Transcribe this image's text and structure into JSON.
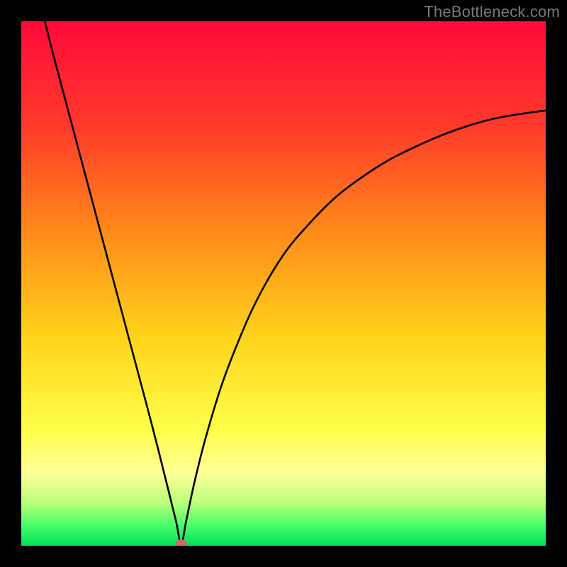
{
  "watermark": "TheBottleneck.com",
  "chart_data": {
    "type": "line",
    "title": "",
    "xlabel": "",
    "ylabel": "",
    "xlim": [
      0,
      100
    ],
    "ylim": [
      0,
      100
    ],
    "gradient_stops": [
      {
        "offset": 0,
        "color": "#ff0a3a"
      },
      {
        "offset": 20,
        "color": "#ff3a2a"
      },
      {
        "offset": 40,
        "color": "#ff8a1a"
      },
      {
        "offset": 60,
        "color": "#ffd21a"
      },
      {
        "offset": 78,
        "color": "#ffff4a"
      },
      {
        "offset": 86,
        "color": "#ffff9a"
      },
      {
        "offset": 92,
        "color": "#b8ff7a"
      },
      {
        "offset": 96,
        "color": "#4aff6a"
      },
      {
        "offset": 100,
        "color": "#00e05a"
      }
    ],
    "curve_anchors": {
      "left_top": {
        "x": 4.5,
        "y": 100
      },
      "min_point": {
        "x": 30.5,
        "y": 0.5
      },
      "right_end": {
        "x": 100,
        "y": 83
      }
    },
    "marker": {
      "x": 30.5,
      "y": 0.5,
      "rx": 1.1,
      "ry": 0.7,
      "color": "#c86a6a"
    },
    "series": [
      {
        "name": "curve",
        "x": [
          4.5,
          6,
          8,
          10,
          12,
          14,
          16,
          18,
          20,
          22,
          24,
          26,
          28,
          29.5,
          30.5,
          31.5,
          33,
          35,
          38,
          41,
          45,
          50,
          55,
          60,
          65,
          70,
          75,
          80,
          85,
          90,
          95,
          100
        ],
        "y": [
          100,
          94,
          86.5,
          79,
          71.5,
          64,
          56.5,
          49,
          41.5,
          34,
          26.5,
          18.8,
          10.8,
          4.7,
          0.5,
          5.0,
          12.0,
          20.0,
          30.0,
          38.0,
          47.0,
          55.5,
          61.5,
          66.5,
          70.3,
          73.5,
          76.0,
          78.2,
          80.0,
          81.4,
          82.3,
          83.0
        ]
      }
    ]
  }
}
